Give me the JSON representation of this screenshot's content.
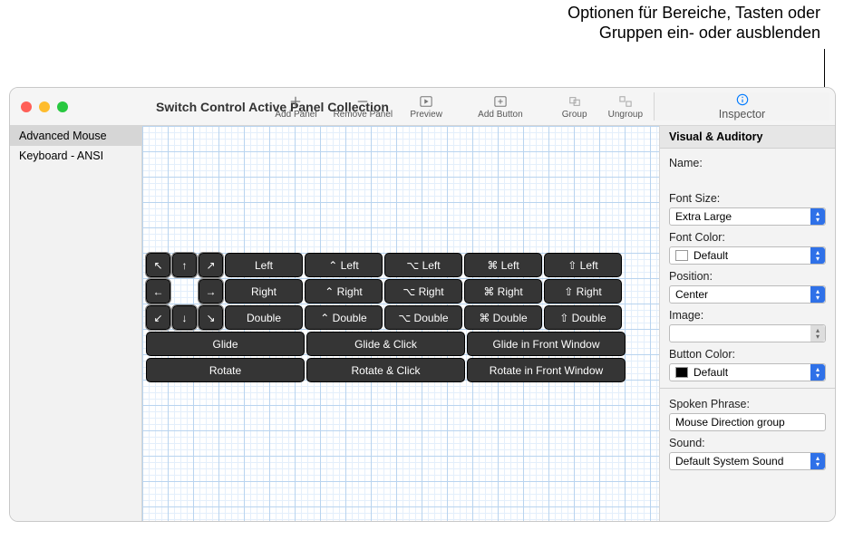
{
  "callout": {
    "line1": "Optionen für Bereiche, Tasten oder",
    "line2": "Gruppen ein- oder ausblenden"
  },
  "window": {
    "title": "Switch Control Active Panel Collection"
  },
  "toolbar": {
    "add_panel": "Add Panel",
    "remove_panel": "Remove Panel",
    "preview": "Preview",
    "add_button": "Add Button",
    "group": "Group",
    "ungroup": "Ungroup",
    "inspector": "Inspector"
  },
  "sidebar": {
    "items": [
      {
        "label": "Advanced Mouse",
        "selected": true
      },
      {
        "label": "Keyboard - ANSI",
        "selected": false
      }
    ]
  },
  "panel_buttons": {
    "dir_icons": {
      "r1": [
        "↖",
        "↑",
        "↗"
      ],
      "r2": [
        "←",
        "",
        "→"
      ],
      "r3": [
        "↙",
        "↓",
        "↘"
      ]
    },
    "cols": [
      {
        "r1": "Left",
        "r2": "Right",
        "r3": "Double"
      },
      {
        "r1": "⌃ Left",
        "r2": "⌃ Right",
        "r3": "⌃ Double"
      },
      {
        "r1": "⌥ Left",
        "r2": "⌥ Right",
        "r3": "⌥ Double"
      },
      {
        "r1": "⌘ Left",
        "r2": "⌘ Right",
        "r3": "⌘ Double"
      },
      {
        "r1": "⇧ Left",
        "r2": "⇧ Right",
        "r3": "⇧ Double"
      }
    ],
    "wide_rows": [
      [
        "Glide",
        "Glide & Click",
        "Glide in Front Window"
      ],
      [
        "Rotate",
        "Rotate & Click",
        "Rotate in Front Window"
      ]
    ]
  },
  "inspector": {
    "header": "Visual & Auditory",
    "name_label": "Name:",
    "name_value": "",
    "font_size_label": "Font Size:",
    "font_size_value": "Extra Large",
    "font_color_label": "Font Color:",
    "font_color_value": "Default",
    "position_label": "Position:",
    "position_value": "Center",
    "image_label": "Image:",
    "image_value": "",
    "button_color_label": "Button Color:",
    "button_color_value": "Default",
    "spoken_label": "Spoken Phrase:",
    "spoken_value": "Mouse Direction group",
    "sound_label": "Sound:",
    "sound_value": "Default System Sound"
  }
}
